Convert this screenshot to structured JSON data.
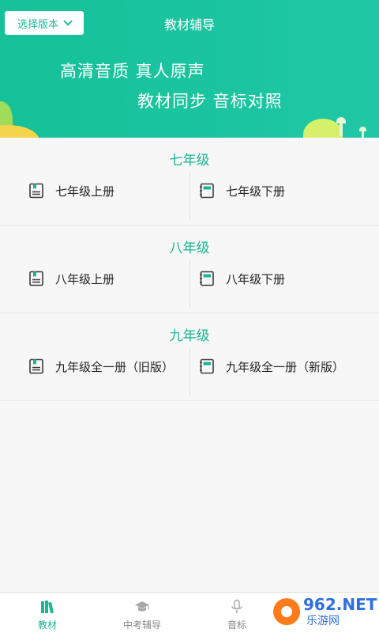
{
  "header": {
    "version_button": "选择版本",
    "title": "教材辅导",
    "slogan_line1": "高清音质  真人原声",
    "slogan_line2": "教材同步  音标对照"
  },
  "grades": [
    {
      "title": "七年级",
      "left": "七年级上册",
      "right": "七年级下册"
    },
    {
      "title": "八年级",
      "left": "八年级上册",
      "right": "八年级下册"
    },
    {
      "title": "九年级",
      "left": "九年级全一册（旧版）",
      "right": "九年级全一册（新版）"
    }
  ],
  "bottom_nav": {
    "items": [
      {
        "label": "教材",
        "icon": "books-icon",
        "active": true
      },
      {
        "label": "中考辅导",
        "icon": "graduation-cap-icon",
        "active": false
      },
      {
        "label": "音标",
        "icon": "microphone-icon",
        "active": false
      },
      {
        "label": "",
        "icon": "",
        "active": false
      }
    ]
  },
  "watermark": {
    "brand": "962.NET",
    "subtitle": "乐游网"
  },
  "colors": {
    "primary": "#1bb592",
    "header_gradient_start": "#15c198",
    "header_gradient_end": "#20c7a6"
  }
}
